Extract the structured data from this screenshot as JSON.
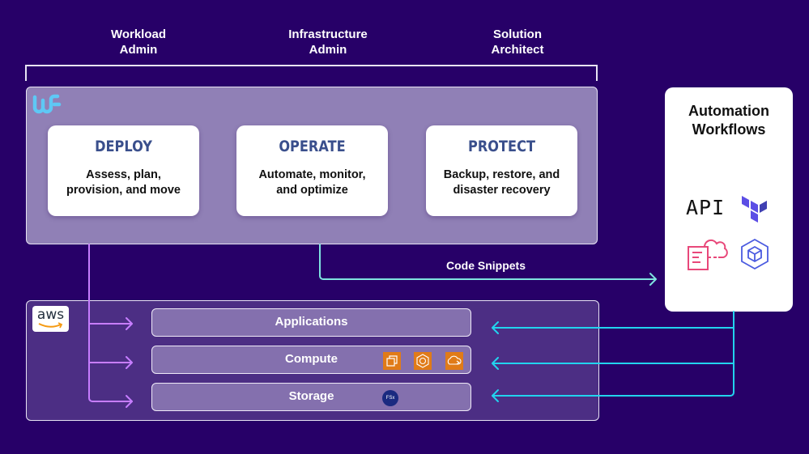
{
  "roles": [
    {
      "line1": "Workload",
      "line2": "Admin"
    },
    {
      "line1": "Infrastructure",
      "line2": "Admin"
    },
    {
      "line1": "Solution",
      "line2": "Architect"
    }
  ],
  "workload_factory": {
    "logo_icon": "wf-logo-icon",
    "cards": [
      {
        "title": "DEPLOY",
        "desc_line1": "Assess, plan,",
        "desc_line2": "provision, and move"
      },
      {
        "title": "OPERATE",
        "desc_line1": "Automate, monitor,",
        "desc_line2": "and optimize"
      },
      {
        "title": "PROTECT",
        "desc_line1": "Backup, restore, and",
        "desc_line2": "disaster recovery"
      }
    ]
  },
  "automation_workflows": {
    "title_line1": "Automation",
    "title_line2": "Workflows",
    "icons": [
      "api-icon",
      "terraform-icon",
      "cloudformation-icon",
      "cdk-icon"
    ],
    "api_label": "API"
  },
  "code_snippets_label": "Code Snippets",
  "aws": {
    "logo_text": "aws",
    "layers": [
      {
        "label": "Applications",
        "icons": []
      },
      {
        "label": "Compute",
        "icons": [
          "ec2-icon",
          "eks-icon",
          "ecs-icon"
        ]
      },
      {
        "label": "Storage",
        "icons": [
          "fsx-ontap-icon"
        ]
      }
    ],
    "fsx_label": "FSx"
  },
  "colors": {
    "background": "#270068",
    "wf_panel": "#9080b6",
    "aws_panel": "#4c2e84",
    "layer": "#8470ae",
    "card_title": "#3a4f8c",
    "pink_arrow": "#c77dff",
    "teal_arrow": "#7fe3e0",
    "cyan_arrow": "#22d3ee",
    "aws_service_orange": "#e07b18",
    "fsx_navy": "#1a2a80"
  }
}
